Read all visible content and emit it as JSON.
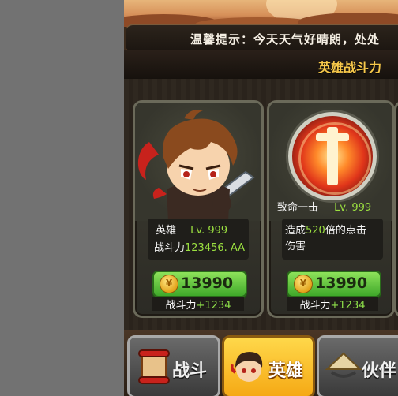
{
  "ticker": {
    "text": "温馨提示：今天天气好晴朗，处处"
  },
  "header": {
    "title": "英雄战斗力"
  },
  "hero_card": {
    "name": "英雄",
    "level": "Lv. 999",
    "power_label": "战斗力",
    "power_value": "123456. AA",
    "cost": "13990",
    "upgrade_label": "战斗力",
    "upgrade_value": "+1234"
  },
  "skill_card": {
    "name": "致命一击",
    "level": "Lv. 999",
    "desc_prefix": "造成",
    "desc_value": "520",
    "desc_suffix": "倍的点击",
    "desc_line2": "伤害",
    "cost": "13990",
    "upgrade_label": "战斗力",
    "upgrade_value": "+1234"
  },
  "tabs": [
    {
      "label": "战斗",
      "icon": "scroll-icon"
    },
    {
      "label": "英雄",
      "icon": "hero-icon"
    },
    {
      "label": "伙伴",
      "icon": "straw-hat-icon"
    }
  ],
  "colors": {
    "accent_green": "#9be040",
    "title_gold": "#f7c84a",
    "tab_active": "#f5a915"
  }
}
